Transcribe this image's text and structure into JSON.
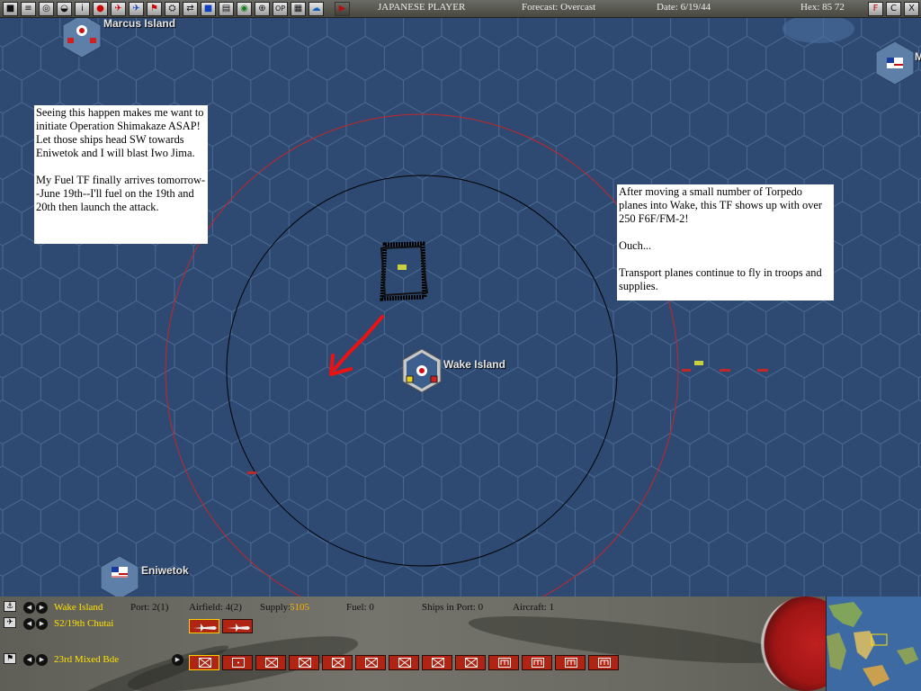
{
  "toolbar": {
    "player": "JAPANESE PLAYER",
    "forecast": "Forecast: Overcast",
    "date": "Date: 6/19/44",
    "hex": "Hex: 85 72",
    "buttons": [
      "save-icon",
      "report-icon",
      "intel-icon",
      "ship-icon",
      "info-icon",
      "target-icon",
      "plane-icon",
      "plane-blue-icon",
      "flag-icon",
      "unit-icon",
      "swap-icon",
      "map-icon",
      "list-icon",
      "globe-icon",
      "zoom-icon",
      "op-icon",
      "chart-icon",
      "weather-icon"
    ],
    "op_label": "OP",
    "play_label": "▶",
    "right_buttons": [
      "F",
      "C",
      "X"
    ]
  },
  "map": {
    "bases": {
      "marcus": "Marcus Island",
      "wake": "Wake Island",
      "eniwetok": "Eniwetok",
      "us_top_right": "M"
    },
    "notes": {
      "left": [
        "Seeing this happen makes me want to initiate Operation Shimakaze ASAP!  Let those ships head SW towards Eniwetok and I will blast Iwo Jima.",
        "My Fuel TF finally arrives tomorrow--June 19th--I'll fuel on the 19th and 20th then launch the attack."
      ],
      "right": [
        "After moving a small number of Torpedo planes into Wake, this TF shows up with over 250 F6F/FM-2!",
        "Ouch...",
        "Transport planes continue to fly in troops and supplies."
      ]
    },
    "colors": {
      "sea": "#2f4a72",
      "hex_line": "#4a6a93",
      "outer_circle": "#c02828",
      "inner_circle": "#000000",
      "arrow": "#ee1111"
    }
  },
  "panel": {
    "base_name": "Wake Island",
    "port": "Port: 2(1)",
    "airfield": "Airfield: 4(2)",
    "supply_label": "Supply:",
    "supply_value": "5105",
    "fuel": "Fuel: 0",
    "ships_in_port": "Ships in Port: 0",
    "aircraft": "Aircraft: 1",
    "air_unit": "S2/19th Chutai",
    "land_unit": "23rd Mixed Bde",
    "unit_buttons": [
      "infantry",
      "hq",
      "infantry",
      "infantry",
      "infantry",
      "infantry",
      "infantry",
      "infantry",
      "infantry",
      "engineer",
      "engineer",
      "engineer",
      "engineer"
    ]
  }
}
